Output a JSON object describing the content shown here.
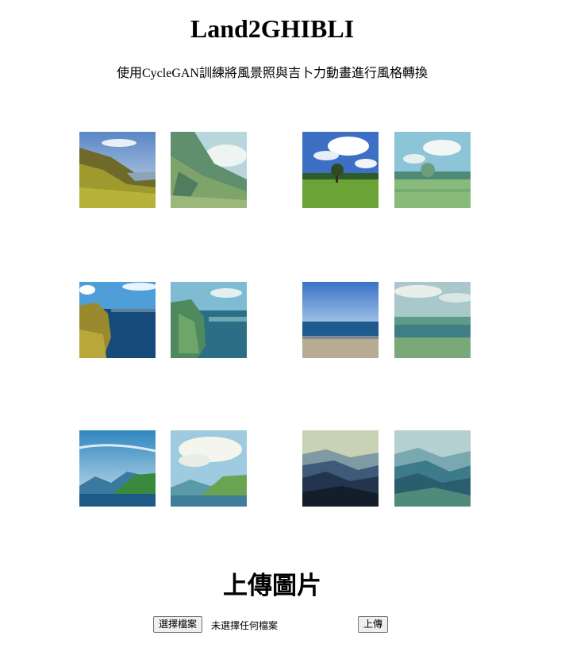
{
  "header": {
    "title": "Land2GHIBLI",
    "subtitle": "使用CycleGAN訓練將風景照與吉卜力動畫進行風格轉換"
  },
  "gallery": {
    "pairs": [
      {
        "original": "landscape-hills-photo",
        "converted": "landscape-hills-ghibli"
      },
      {
        "original": "landscape-tree-photo",
        "converted": "landscape-tree-ghibli"
      },
      {
        "original": "landscape-cliff-photo",
        "converted": "landscape-cliff-ghibli"
      },
      {
        "original": "landscape-beach-photo",
        "converted": "landscape-beach-ghibli"
      },
      {
        "original": "landscape-mountains-sky-photo",
        "converted": "landscape-mountains-sky-ghibli"
      },
      {
        "original": "landscape-misty-ridges-photo",
        "converted": "landscape-misty-ridges-ghibli"
      }
    ]
  },
  "upload": {
    "heading": "上傳圖片",
    "choose_label": "選擇檔案",
    "status_text": "未選擇任何檔案",
    "submit_label": "上傳"
  }
}
